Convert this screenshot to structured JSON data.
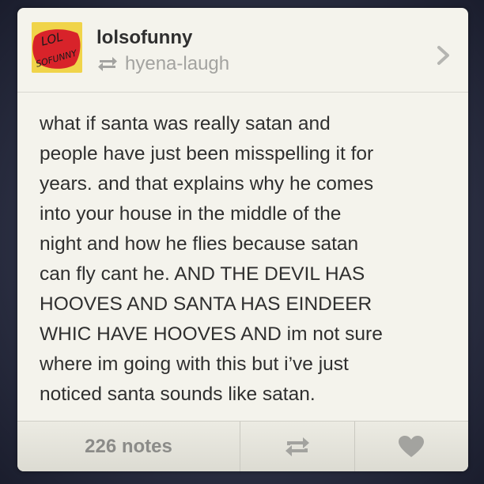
{
  "post": {
    "username": "lolsofunny",
    "reblogged_from": "hyena-laugh",
    "avatar_text": "LOL SOFUNNY",
    "body": "what if santa was really satan and\npeople have just been misspelling it for\nyears. and that explains why he comes\ninto your house in the middle of the\nnight and how he flies because satan\ncan fly cant he. AND THE DEVIL HAS\nHOOVES AND SANTA HAS EINDEER\nWHIC HAVE HOOVES AND im not sure\nwhere im going with this but i’ve just\nnoticed santa sounds like satan."
  },
  "footer": {
    "notes": "226 notes"
  },
  "icons": {
    "reblog": "reblog-icon",
    "like": "heart-icon",
    "open": "chevron-right-icon"
  },
  "colors": {
    "background": "#2e3246",
    "card": "#f4f3ec",
    "text": "#2f2f2f",
    "muted": "#a3a3a0",
    "avatar_yellow": "#f0d44a",
    "avatar_red": "#d8232a"
  }
}
